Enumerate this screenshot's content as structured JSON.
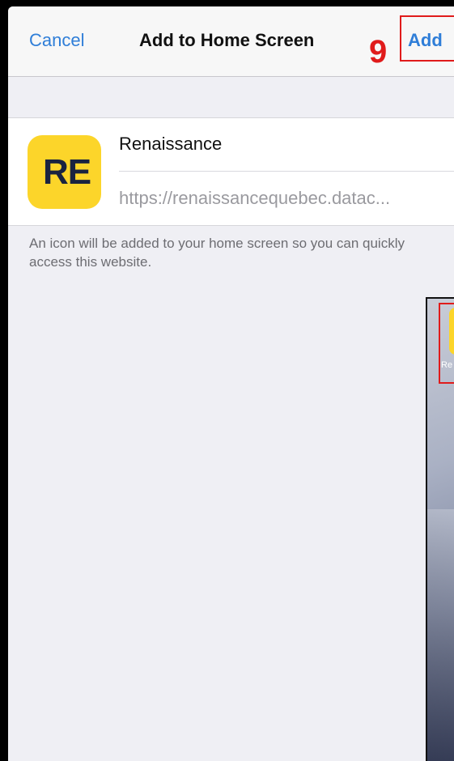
{
  "navbar": {
    "cancel_label": "Cancel",
    "title": "Add to Home Screen",
    "add_label": "Add"
  },
  "annotation": {
    "step_number": "9"
  },
  "bookmark": {
    "icon_text": "RE",
    "name_value": "Renaissance",
    "url": "https://renaissancequebec.datac..."
  },
  "description": "An icon will be added to your home screen so you can quickly access this website.",
  "preview": {
    "app_label": "Re"
  },
  "colors": {
    "accent_blue": "#2f7ed8",
    "highlight_red": "#e01b1b",
    "icon_yellow": "#fcd52a",
    "icon_text_navy": "#1a2340",
    "background": "#efeff4"
  },
  "icons": {
    "app_icon": "renaissance-app-icon"
  }
}
